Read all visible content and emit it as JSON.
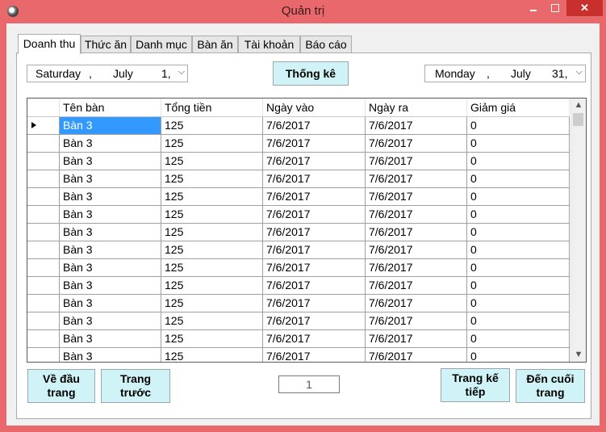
{
  "window": {
    "title": "Quản trị",
    "close_glyph": "✕",
    "minimize_glyph": "—"
  },
  "tabs": [
    "Doanh thu",
    "Thức ăn",
    "Danh mục",
    "Bàn ăn",
    "Tài khoản",
    "Báo cáo"
  ],
  "active_tab": "Doanh thu",
  "date_from": {
    "weekday": "Saturday",
    "month": "July",
    "day": "1,"
  },
  "date_to": {
    "weekday": "Monday",
    "month": "July",
    "day": "31,"
  },
  "stats_button": "Thống kê",
  "table": {
    "columns": [
      "Tên bàn",
      "Tổng tiền",
      "Ngày vào",
      "Ngày ra",
      "Giảm giá"
    ],
    "rows": [
      [
        "Bàn 3",
        "125",
        "7/6/2017",
        "7/6/2017",
        "0"
      ],
      [
        "Bàn 3",
        "125",
        "7/6/2017",
        "7/6/2017",
        "0"
      ],
      [
        "Bàn 3",
        "125",
        "7/6/2017",
        "7/6/2017",
        "0"
      ],
      [
        "Bàn 3",
        "125",
        "7/6/2017",
        "7/6/2017",
        "0"
      ],
      [
        "Bàn 3",
        "125",
        "7/6/2017",
        "7/6/2017",
        "0"
      ],
      [
        "Bàn 3",
        "125",
        "7/6/2017",
        "7/6/2017",
        "0"
      ],
      [
        "Bàn 3",
        "125",
        "7/6/2017",
        "7/6/2017",
        "0"
      ],
      [
        "Bàn 3",
        "125",
        "7/6/2017",
        "7/6/2017",
        "0"
      ],
      [
        "Bàn 3",
        "125",
        "7/6/2017",
        "7/6/2017",
        "0"
      ],
      [
        "Bàn 3",
        "125",
        "7/6/2017",
        "7/6/2017",
        "0"
      ],
      [
        "Bàn 3",
        "125",
        "7/6/2017",
        "7/6/2017",
        "0"
      ],
      [
        "Bàn 3",
        "125",
        "7/6/2017",
        "7/6/2017",
        "0"
      ],
      [
        "Bàn 3",
        "125",
        "7/6/2017",
        "7/6/2017",
        "0"
      ],
      [
        "Bàn 3",
        "125",
        "7/6/2017",
        "7/6/2017",
        "0"
      ]
    ]
  },
  "pager": {
    "first": "Về đầu\ntrang",
    "prev": "Trang\ntrước",
    "page": "1",
    "next": "Trang kế\ntiếp",
    "last": "Đến cuối\ntrang"
  },
  "colors": {
    "title_bar": "#e8686b",
    "button": "#cff3f6",
    "selection": "#3399ff"
  }
}
